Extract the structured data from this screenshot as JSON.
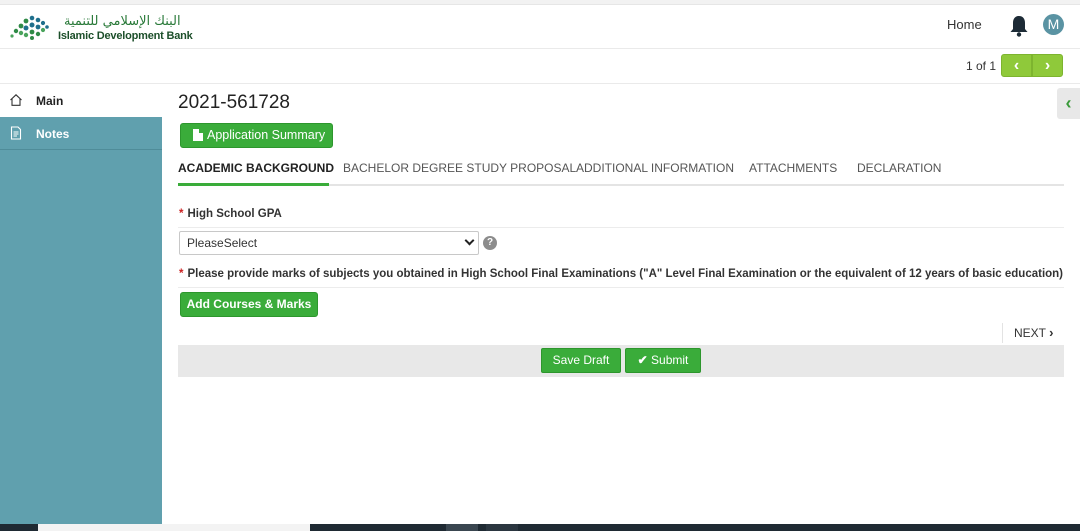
{
  "header": {
    "logo_arabic": "البنك الإسلامي للتنمية",
    "logo_english": "Islamic Development Bank",
    "home_label": "Home",
    "avatar_initial": "M"
  },
  "pager": {
    "text": "1 of 1",
    "prev_symbol": "‹",
    "next_symbol": "›"
  },
  "sidebar": {
    "items": [
      {
        "label": "Main",
        "icon": "home-icon",
        "active": true
      },
      {
        "label": "Notes",
        "icon": "document-icon",
        "active": false
      }
    ]
  },
  "main": {
    "application_id": "2021-561728",
    "summary_button_label": "Application Summary",
    "tabs": [
      {
        "label": "ACADEMIC BACKGROUND",
        "active": true
      },
      {
        "label": "BACHELOR DEGREE STUDY PROPOSAL",
        "active": false
      },
      {
        "label": "ADDITIONAL INFORMATION",
        "active": false
      },
      {
        "label": "ATTACHMENTS",
        "active": false
      },
      {
        "label": "DECLARATION",
        "active": false
      }
    ],
    "gpa_label": "High School GPA",
    "required_marker": "*",
    "gpa_select_value": "PleaseSelect",
    "help_symbol": "?",
    "marks_label": "Please provide marks of subjects you obtained in High School Final Examinations (\"A\" Level Final Examination or the equivalent of 12 years of basic education)",
    "add_courses_label": "Add Courses & Marks",
    "next_label": "NEXT",
    "next_symbol": "›"
  },
  "actions": {
    "save_draft_label": "Save Draft",
    "submit_label": "Submit"
  },
  "colors": {
    "accent_green": "#3aac3a",
    "pager_green": "#8fc93a",
    "sidebar_teal": "#60a0ae",
    "avatar_blue": "#5a93a3"
  }
}
